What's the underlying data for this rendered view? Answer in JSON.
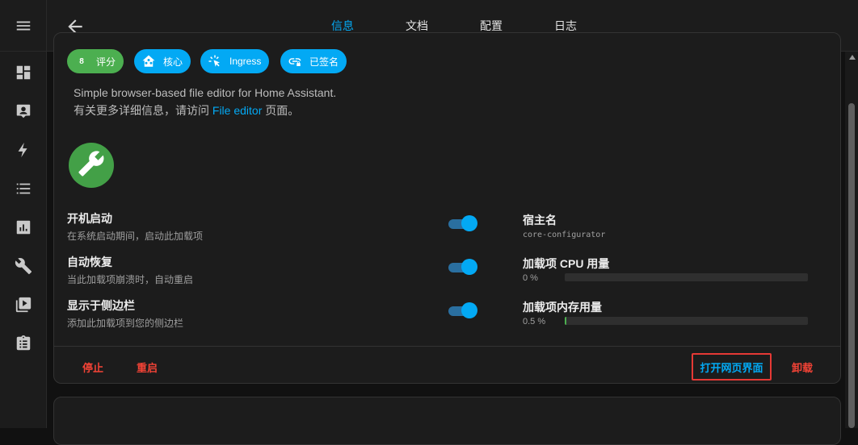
{
  "tabs": [
    {
      "label": "信息",
      "active": true
    },
    {
      "label": "文档",
      "active": false
    },
    {
      "label": "配置",
      "active": false
    },
    {
      "label": "日志",
      "active": false
    }
  ],
  "chips": [
    {
      "icon_text": "8",
      "label": "评分",
      "color": "#4caf50"
    },
    {
      "icon": "home-assistant-icon",
      "label": "核心",
      "color": "#03a9f4"
    },
    {
      "icon": "cursor-click-icon",
      "label": "Ingress",
      "color": "#03a9f4"
    },
    {
      "icon": "link-lock-icon",
      "label": "已签名",
      "color": "#03a9f4"
    }
  ],
  "description": {
    "line1": "Simple browser-based file editor for Home Assistant.",
    "line2_prefix": "有关更多详细信息，请访问 ",
    "line2_link": "File editor",
    "line2_suffix": " 页面。"
  },
  "options": [
    {
      "title": "开机启动",
      "subtitle": "在系统启动期间，启动此加载项",
      "enabled": true
    },
    {
      "title": "自动恢复",
      "subtitle": "当此加载项崩溃时，自动重启",
      "enabled": true
    },
    {
      "title": "显示于侧边栏",
      "subtitle": "添加此加载项到您的侧边栏",
      "enabled": true
    }
  ],
  "info": {
    "hostname_label": "宿主名",
    "hostname_value": "core-configurator",
    "cpu_label": "加载项 CPU 用量",
    "cpu_value_text": "0 %",
    "cpu_percent": 0,
    "mem_label": "加载项内存用量",
    "mem_value_text": "0.5 %",
    "mem_percent": 0.5
  },
  "actions": {
    "stop": "停止",
    "restart": "重启",
    "open_web_ui": "打开网页界面",
    "uninstall": "卸载"
  },
  "colors": {
    "accent": "#03a9f4",
    "danger": "#f44336",
    "success": "#4caf50"
  }
}
